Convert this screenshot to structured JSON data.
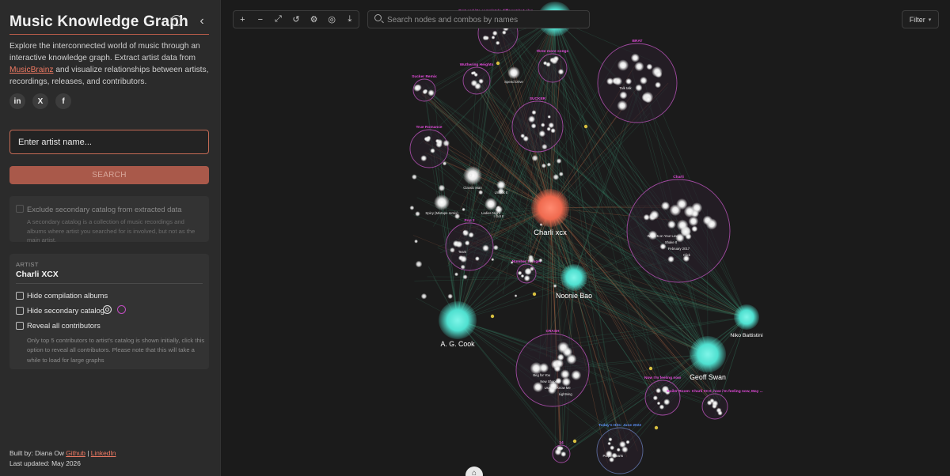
{
  "sidebar": {
    "title": "Music Knowledge Graph",
    "info_icon": "info-icon",
    "collapse_icon": "chevron-left-icon",
    "intro_text_1": "Explore the interconnected world of music through an interactive knowledge graph. Extract artist data from ",
    "intro_link": "MusicBrainz",
    "intro_text_2": " and visualize relationships between artists, recordings, releases, and contributors.",
    "socials": [
      {
        "name": "linkedin-icon",
        "glyph": "in"
      },
      {
        "name": "x-icon",
        "glyph": "X"
      },
      {
        "name": "facebook-icon",
        "glyph": "f"
      }
    ],
    "artist_input_placeholder": "Enter artist name...",
    "search_label": "SEARCH",
    "exclude_label": "Exclude secondary catalog from extracted data",
    "exclude_desc": "A secondary catalog is a collection of music recordings and albums where artist you searched for is involved, but not as the main artist.",
    "artist_caption": "ARTIST",
    "artist_name": "Charli XCX",
    "options": {
      "hide_compilation": "Hide compilation albums",
      "hide_secondary": "Hide secondary catalog",
      "reveal_contributors": "Reveal all contributors"
    },
    "reveal_desc": "Only top 5 contributors to artist's catalog is shown initially, click this option to reveal all contributors. Please note that this will take a while to load for large graphs",
    "footer": {
      "built_by": "Built by: Diana Ow ",
      "github": "Github",
      "separator": " | ",
      "linkedin": "LinkedIn",
      "last_updated": "Last updated: May 2026"
    }
  },
  "toolbar": {
    "buttons": [
      {
        "name": "zoom-in-icon",
        "glyph": "+"
      },
      {
        "name": "zoom-out-icon",
        "glyph": "−"
      },
      {
        "name": "fit-view-icon",
        "glyph": "⤢"
      },
      {
        "name": "reset-icon",
        "glyph": "↺"
      },
      {
        "name": "layout-settings-icon",
        "glyph": "⚙"
      },
      {
        "name": "focus-icon",
        "glyph": "◎"
      },
      {
        "name": "download-icon",
        "glyph": "⤓"
      }
    ],
    "search_placeholder": "Search nodes and combos by names",
    "filter_label": "Filter",
    "filter_chevron": "chevron-down-icon"
  },
  "graph": {
    "colors": {
      "artist_node": "#ef6a4f",
      "contributor_node": "#4fe0d0",
      "combo_border": "#a04aa0",
      "combo_title": "#e04ad8",
      "combo_title_blue": "#5a8cf0",
      "compilation_border": "#5a6a9a",
      "edge_green": "#3a8a6a",
      "edge_orange": "#c0704a",
      "edge_yellow": "#d8c040"
    },
    "main_artist": "Charli xcx",
    "contributors": [
      "A. G. Cook",
      "Noonie Bao",
      "Geoff Swan",
      "Niko Battistini"
    ],
    "combos": [
      {
        "title": "BRAT",
        "tracks": [
          "Talk talk"
        ]
      },
      {
        "title": "Charli",
        "tracks": [
          "Warm 5 on Your Love",
          "Shake It",
          "February 2017",
          "Click"
        ]
      },
      {
        "title": "CRASH",
        "tracks": [
          "Beg for You",
          "New Shapes",
          "Used to Know Me",
          "Lightning"
        ]
      },
      {
        "title": "True Romance",
        "tracks": []
      },
      {
        "title": "Wuthering Heights",
        "tracks": []
      },
      {
        "title": "SUCKER",
        "tracks": []
      },
      {
        "title": "Pop 2",
        "tracks": [
          "Tears"
        ]
      },
      {
        "title": "Sucker Remix",
        "tracks": []
      },
      {
        "title": "Number 1 Angel",
        "tracks": []
      },
      {
        "title": "Now I'm feeling now",
        "tracks": []
      },
      {
        "title": "Boiler Room: Charli XCX, how i'm feeling now, May ...",
        "tracks": []
      },
      {
        "title": "Brat and it's completely different but also ...",
        "tracks": []
      },
      {
        "title": "three more songs",
        "tracks": []
      },
      {
        "title": "14",
        "tracks": []
      },
      {
        "title": "Today's Hits: June 2022",
        "tracks": [
          "Purple Hearts"
        ]
      }
    ],
    "loose_labels": [
      "Speed Drive",
      "Classic Man",
      "Spicy (Mixtape remix)",
      "Ladies Night",
      "Unlock It",
      "I Got It"
    ]
  }
}
